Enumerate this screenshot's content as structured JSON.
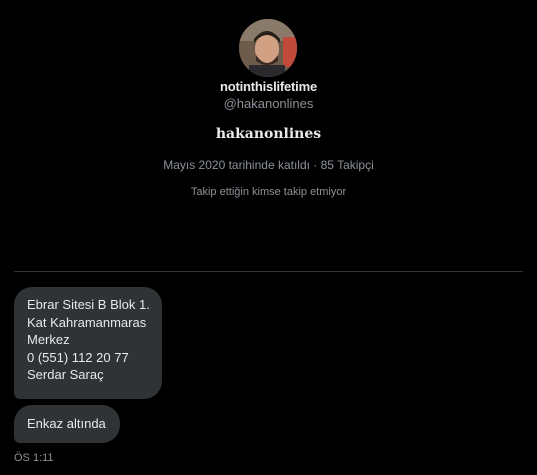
{
  "profile": {
    "display_name": "notinthislifetime",
    "handle": "@hakanonlines",
    "bio": "hakanonlines",
    "joined_followers": "Mayıs 2020 tarihinde katıldı · 85 Takipçi",
    "mutual_followers": "Takip ettiğin kimse takip etmiyor"
  },
  "conversation": {
    "messages": [
      {
        "text": "Ebrar Sitesi B Blok 1.\nKat Kahramanmaras\nMerkez\n0 (551) 112 20 77\nSerdar Saraç"
      },
      {
        "text": "Enkaz altında"
      }
    ],
    "timestamp": "ÖS 1:11"
  },
  "colors": {
    "background": "#000000",
    "bubble": "#2f3336",
    "primary_text": "#e7e9ea",
    "secondary_text": "#8b9198",
    "divider": "#2f3336"
  }
}
